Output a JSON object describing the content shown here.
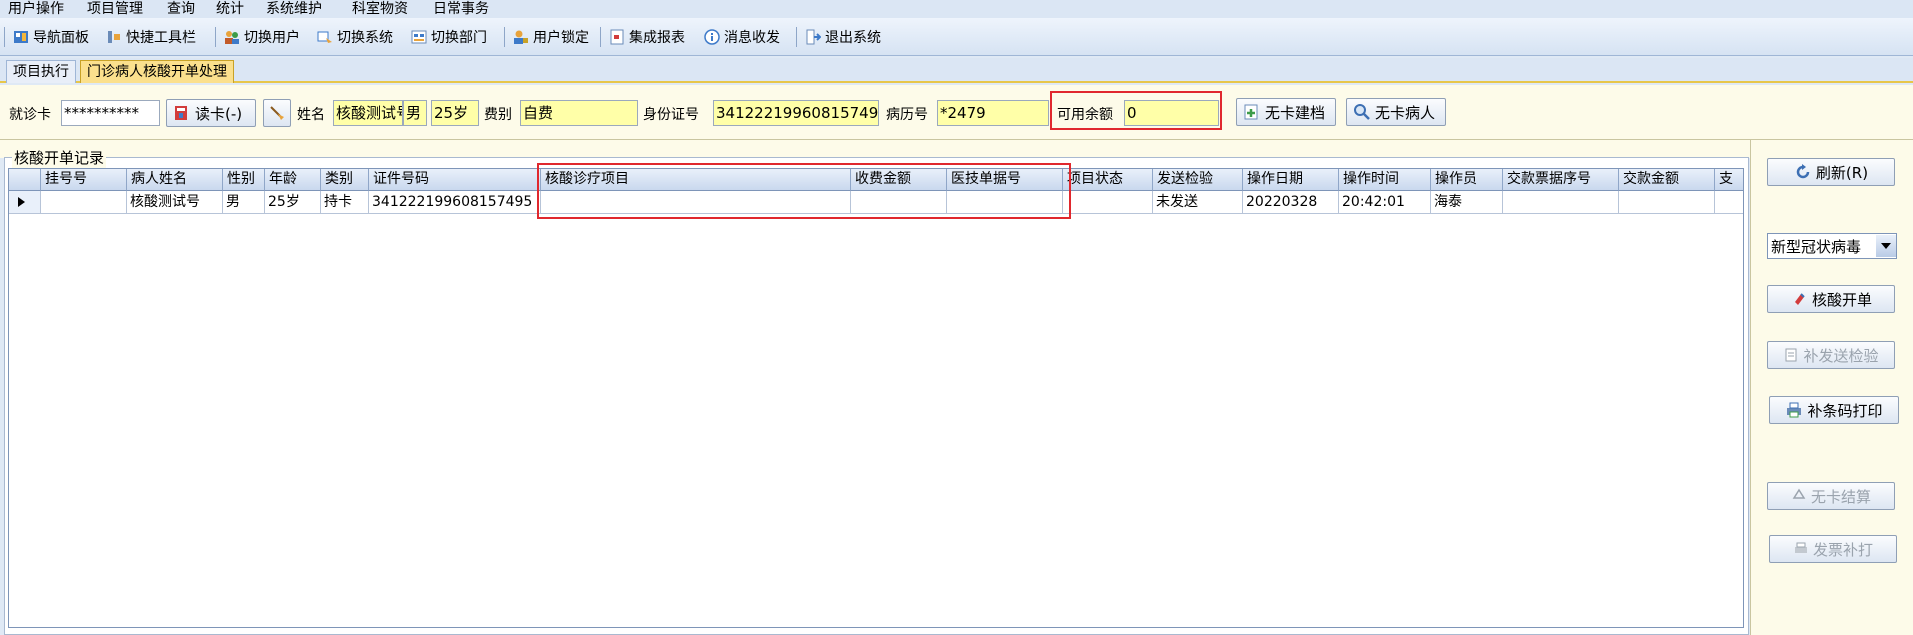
{
  "menu": [
    "用户操作",
    "项目管理",
    "查询",
    "统计",
    "系统维护",
    "科室物资",
    "日常事务"
  ],
  "toolbar": {
    "nav": "导航面板",
    "quick": "快捷工具栏",
    "switch_user": "切换用户",
    "switch_system": "切换系统",
    "switch_dept": "切换部门",
    "lock_user": "用户锁定",
    "report": "集成报表",
    "message": "消息收发",
    "exit": "退出系统"
  },
  "tabs": [
    "项目执行",
    "门诊病人核酸开单处理"
  ],
  "patient": {
    "card_label": "就诊卡",
    "card_value": "**********",
    "read_card": "读卡(-)",
    "name_label": "姓名",
    "name_value": "核酸测试号",
    "sex_value": "男",
    "age_value": "25岁",
    "fee_label": "费别",
    "fee_value": "自费",
    "id_label": "身份证号",
    "id_value": "341222199608157495",
    "record_label": "病历号",
    "record_value": "*2479",
    "balance_label": "可用余额",
    "balance_value": "0",
    "no_card_file": "无卡建档",
    "no_card_patient": "无卡病人"
  },
  "group_title": "核酸开单记录",
  "grid": {
    "columns": [
      "挂号号",
      "病人姓名",
      "性别",
      "年龄",
      "类别",
      "证件号码",
      "核酸诊疗项目",
      "收费金额",
      "医技单据号",
      "项目状态",
      "发送检验",
      "操作日期",
      "操作时间",
      "操作员",
      "交款票据序号",
      "交款金额",
      "支"
    ],
    "rows": [
      [
        "",
        "核酸测试号",
        "男",
        "25岁",
        "持卡",
        "341222199608157495",
        "",
        "",
        "",
        "",
        "未发送",
        "20220328",
        "20:42:01",
        "海泰",
        "",
        "",
        ""
      ]
    ]
  },
  "right": {
    "refresh": "刷新(R)",
    "select_value": "新型冠状病毒",
    "order": "核酸开单",
    "resend": "补发送检验",
    "barcode": "补条码打印",
    "no_card_settle": "无卡结算",
    "invoice_reprint": "发票补打"
  },
  "colors": {
    "highlight": "#e0282e",
    "field": "#ffffa8",
    "tab_active": "#fbe08d"
  }
}
